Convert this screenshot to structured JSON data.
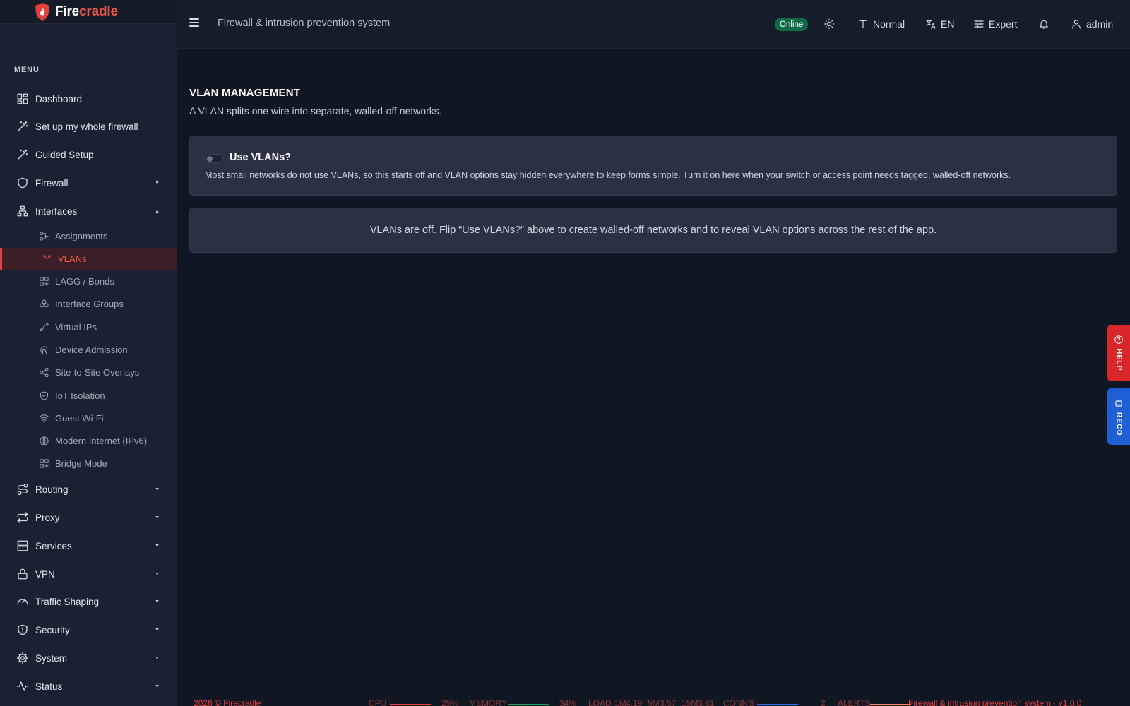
{
  "brand": {
    "prefix": "Fire",
    "suffix": "cradle"
  },
  "sidebar": {
    "heading": "MENU",
    "items": [
      {
        "label": "Dashboard",
        "icon": "dashboard-icon"
      },
      {
        "label": "Set up my whole firewall",
        "icon": "wand-icon"
      },
      {
        "label": "Guided Setup",
        "icon": "wand-icon"
      },
      {
        "label": "Firewall",
        "icon": "shield-icon",
        "expanded": false
      },
      {
        "label": "Interfaces",
        "icon": "network-icon",
        "expanded": true
      },
      {
        "label": "Routing",
        "icon": "route-icon",
        "expanded": false
      },
      {
        "label": "Proxy",
        "icon": "arrows-icon",
        "expanded": false
      },
      {
        "label": "Services",
        "icon": "server-icon",
        "expanded": false
      },
      {
        "label": "VPN",
        "icon": "lock-icon",
        "expanded": false
      },
      {
        "label": "Traffic Shaping",
        "icon": "gauge-icon",
        "expanded": false
      },
      {
        "label": "Security",
        "icon": "shield-alert-icon",
        "expanded": false
      },
      {
        "label": "System",
        "icon": "gear-icon",
        "expanded": false
      },
      {
        "label": "Status",
        "icon": "pulse-icon",
        "expanded": false
      }
    ],
    "interfaces_sub": [
      {
        "label": "Assignments",
        "icon": "plug-icon"
      },
      {
        "label": "VLANs",
        "icon": "vlan-icon",
        "active": true
      },
      {
        "label": "LAGG / Bonds",
        "icon": "bond-icon"
      },
      {
        "label": "Interface Groups",
        "icon": "group-icon"
      },
      {
        "label": "Virtual IPs",
        "icon": "vip-icon"
      },
      {
        "label": "Device Admission",
        "icon": "fingerprint-icon"
      },
      {
        "label": "Site-to-Site Overlays",
        "icon": "share-icon"
      },
      {
        "label": "IoT Isolation",
        "icon": "shield-check-icon"
      },
      {
        "label": "Guest Wi-Fi",
        "icon": "wifi-icon"
      },
      {
        "label": "Modern Internet (IPv6)",
        "icon": "globe-icon"
      },
      {
        "label": "Bridge Mode",
        "icon": "bridge-icon"
      }
    ]
  },
  "topbar": {
    "title": "Firewall & intrusion prevention system",
    "status": "Online",
    "text_size": "Normal",
    "language": "EN",
    "mode": "Expert",
    "user": "admin"
  },
  "main": {
    "title": "VLAN MANAGEMENT",
    "subtitle": "A VLAN splits one wire into separate, walled-off networks.",
    "toggle_label": "Use VLANs?",
    "toggle_on": false,
    "toggle_desc": "Most small networks do not use VLANs, so this starts off and VLAN options stay hidden everywhere to keep forms simple. Turn it on here when your switch or access point needs tagged, walled-off networks.",
    "notice": "VLANs are off. Flip “Use VLANs?” above to create walled-off networks and to reveal VLAN options across the rest of the app."
  },
  "side_buttons": {
    "help": "HELP",
    "reco": "RECO"
  },
  "footer": {
    "copyright": "2026 © Firecradle",
    "cpu_label": "CPU",
    "cpu_value": "25%",
    "mem_label": "MEMORY",
    "mem_value": "34%",
    "load_label": "LOAD",
    "load_1m_label": "1M",
    "load_1m": "4.19",
    "load_5m_label": "5M",
    "load_5m": "3.57",
    "load_15m_label": "15M",
    "load_15m": "3.81",
    "conns_label": "CONNS",
    "conns_value": "2",
    "alerts_label": "ALERTS",
    "version": "Firewall & intrusion prevention system · v1.0.0",
    "colors": {
      "cpu": "#e0413d",
      "memory": "#1f9d57",
      "conns": "#2f6ee0",
      "alerts": "#f28a6a"
    }
  },
  "colors": {
    "accent": "#e0413d",
    "online": "#0f6b45"
  }
}
